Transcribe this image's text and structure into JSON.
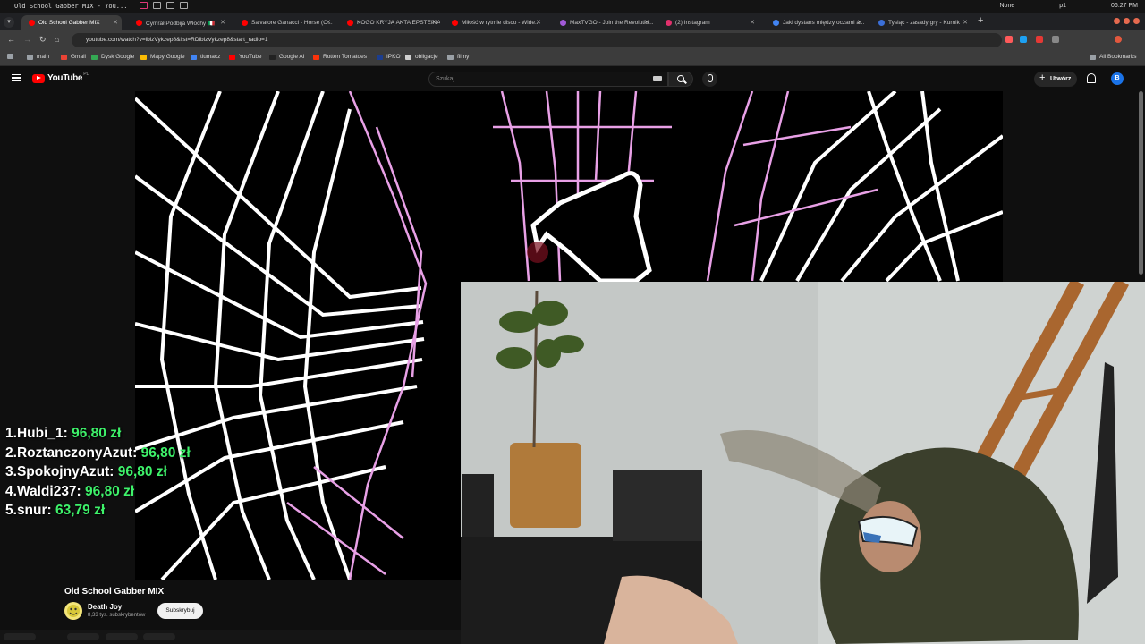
{
  "window": {
    "title": "Old School Gabber MIX - You...",
    "tray_left": "None",
    "tray_mid": "p1",
    "clock": "06:27 PM"
  },
  "tabs": [
    {
      "label": "Old School Gabber MIX",
      "color": "#ff0000",
      "active": true
    },
    {
      "label": "Cymrał Podbija Włochy 🇮🇹",
      "color": "#ff0000"
    },
    {
      "label": "Salvatore Ganacci - Horse (O...",
      "color": "#ff0000"
    },
    {
      "label": "KOGO KRYJĄ AKTA EPSTEINA...",
      "color": "#ff0000"
    },
    {
      "label": "Miłość w rytmie disco - Wide...",
      "color": "#ff0000"
    },
    {
      "label": "MaxTVGO - Join the Revolutio...",
      "color": "#a25ad9"
    },
    {
      "label": "(2) Instagram",
      "color": "#e1306c"
    },
    {
      "label": "Jaki dystans między oczami a...",
      "color": "#4285f4"
    },
    {
      "label": "Tysiąc - zasady gry - Kurnik",
      "color": "#3b6fd8"
    }
  ],
  "address": {
    "url": "youtube.com/watch?v=iblzVykzep8&list=RDiblzVykzep8&start_radio=1"
  },
  "bookmarks": [
    {
      "label": "main",
      "color": "#9aa0a6"
    },
    {
      "label": "Gmail",
      "color": "#ea4335"
    },
    {
      "label": "Dysk Google",
      "color": "#34a853"
    },
    {
      "label": "Mapy Google",
      "color": "#fbbc04"
    },
    {
      "label": "tlumacz",
      "color": "#4285f4"
    },
    {
      "label": "YouTube",
      "color": "#ff0000"
    },
    {
      "label": "Google AI",
      "color": "#222222"
    },
    {
      "label": "Rotten Tomatoes",
      "color": "#fa320a"
    },
    {
      "label": "IPKO",
      "color": "#1b3d8f"
    },
    {
      "label": "obligacje",
      "color": "#cfcfcf"
    },
    {
      "label": "filmy",
      "color": "#9aa0a6"
    }
  ],
  "all_bookmarks": "All Bookmarks",
  "youtube": {
    "logo": "YouTube",
    "region": "PL",
    "search_placeholder": "Szukaj",
    "create_label": "Utwórz",
    "avatar_letter": "B",
    "video_title": "Old School Gabber MIX",
    "channel_name": "Death Joy",
    "channel_subs": "8,33 tys. subskrybentów",
    "subscribe_label": "Subskrybuj"
  },
  "leaderboard": [
    {
      "rank": "1.",
      "name": "Hubi_1:",
      "amount": "96,80 zł"
    },
    {
      "rank": "2.",
      "name": "RoztanczonyAzut:",
      "amount": "96,80 zł"
    },
    {
      "rank": "3.",
      "name": "SpokojnyAzut:",
      "amount": "96,80 zł"
    },
    {
      "rank": "4.",
      "name": "Waldi237:",
      "amount": "96,80 zł"
    },
    {
      "rank": "5.",
      "name": "snur:",
      "amount": "63,79 zł"
    }
  ],
  "icons": [
    "menu-icon",
    "search-icon",
    "microphone-icon",
    "keyboard-icon",
    "bell-icon",
    "plus-icon",
    "back-icon",
    "forward-icon",
    "reload-icon",
    "home-icon"
  ]
}
